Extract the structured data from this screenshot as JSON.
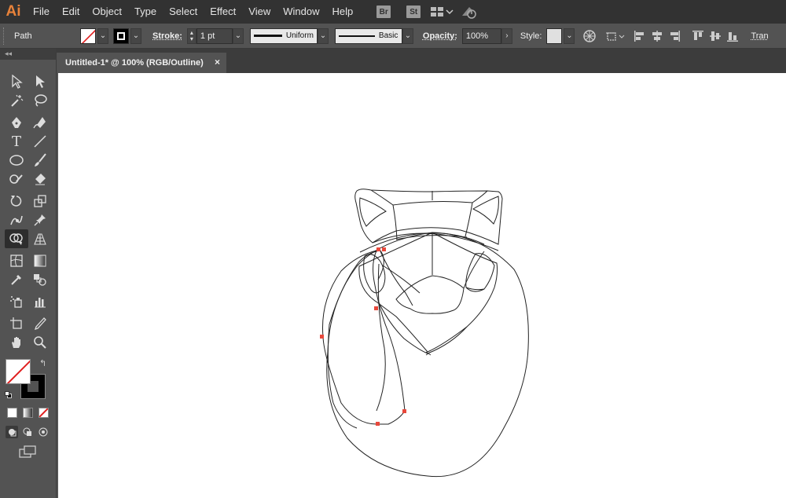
{
  "app": {
    "logo": "Ai"
  },
  "menu": [
    "File",
    "Edit",
    "Object",
    "Type",
    "Select",
    "Effect",
    "View",
    "Window",
    "Help"
  ],
  "app_buttons": [
    "Br",
    "St"
  ],
  "control": {
    "selection_type": "Path",
    "stroke_label": "Stroke:",
    "stroke_weight": "1 pt",
    "profile_label": "Uniform",
    "brush_label": "Basic",
    "opacity_label": "Opacity:",
    "opacity_value": "100%",
    "style_label": "Style:",
    "transform_label": "Tran"
  },
  "panel": {
    "collapse": "◂◂"
  },
  "document": {
    "tab_title": "Untitled-1* @ 100% (RGB/Outline)",
    "close": "×"
  },
  "colors": {
    "anchor": "#e8483b",
    "ui_dark": "#323232",
    "ui_mid": "#535353",
    "accent_logo": "#e8823a"
  }
}
